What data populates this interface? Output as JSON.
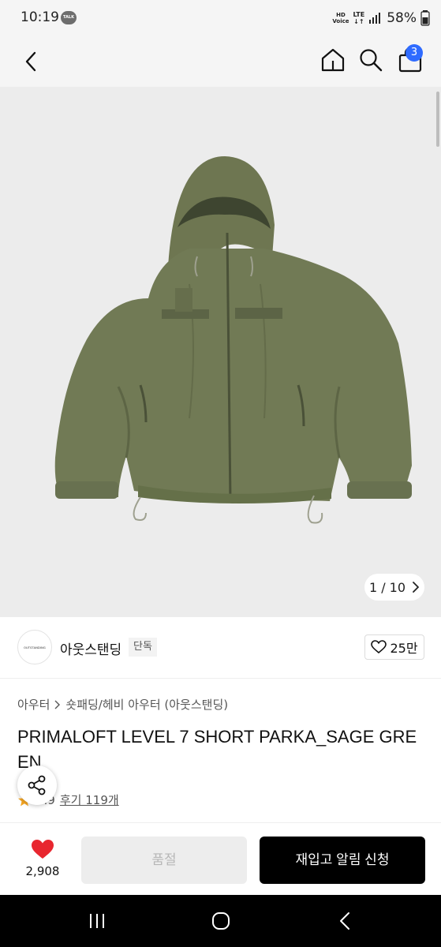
{
  "status_bar": {
    "time": "10:19",
    "talk_label": "TALK",
    "hd_label": "HD",
    "voice_label": "Voice",
    "lte_label": "LTE",
    "battery": "58%"
  },
  "nav": {
    "cart_count": "3"
  },
  "gallery": {
    "pager": "1 / 10"
  },
  "brand": {
    "logo_text": "OUTSTANDING",
    "name": "아웃스탠딩",
    "tag": "단독",
    "likes": "25만"
  },
  "breadcrumb": {
    "category": "아우터",
    "subcategory": "숏패딩/헤비 아우터 (아웃스탠딩)"
  },
  "product": {
    "title": "PRIMALOFT LEVEL 7 SHORT PARKA_SAGE GREEN",
    "rating": "4.9",
    "reviews": "후기 119개"
  },
  "actions": {
    "wish_count": "2,908",
    "soldout_label": "품절",
    "restock_label": "재입고 알림 신청"
  },
  "colors": {
    "accent": "#2f6bff",
    "heart": "#e8262f",
    "jacket": "#717a55",
    "star": "#f5a623"
  }
}
